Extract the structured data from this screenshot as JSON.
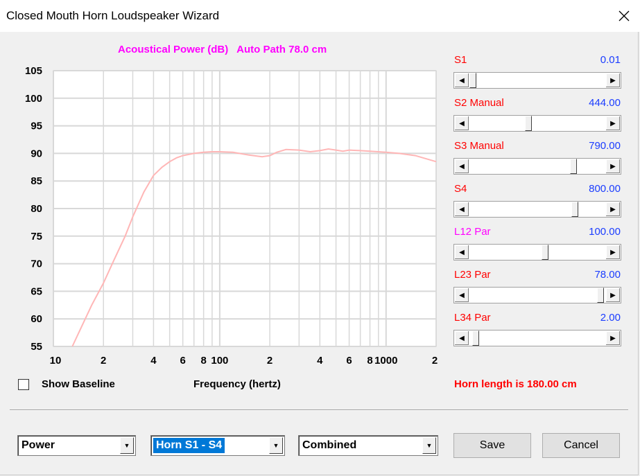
{
  "window": {
    "title": "Closed Mouth Horn Loudspeaker Wizard"
  },
  "chart": {
    "title": "Acoustical Power (dB)   Auto Path 78.0 cm",
    "xlabel": "Frequency (hertz)",
    "y_ticks": [
      "105",
      "100",
      "95",
      "90",
      "85",
      "80",
      "75",
      "70",
      "65",
      "60",
      "55"
    ],
    "x_ticks": [
      "10",
      "2",
      "4",
      "6",
      "8",
      "100",
      "2",
      "4",
      "6",
      "8",
      "1000",
      "2"
    ]
  },
  "chart_data": {
    "type": "line",
    "title": "Acoustical Power (dB)   Auto Path 78.0 cm",
    "xlabel": "Frequency (hertz)",
    "ylabel": "",
    "xscale": "log",
    "xlim": [
      10,
      2000
    ],
    "ylim": [
      55,
      105
    ],
    "grid": true,
    "line_color": "#ffb6b6",
    "series": [
      {
        "x": [
          13,
          15,
          17,
          20,
          23,
          27,
          30,
          35,
          40,
          45,
          50,
          55,
          60,
          70,
          80,
          90,
          100,
          120,
          150,
          180,
          200,
          220,
          250,
          300,
          350,
          400,
          450,
          500,
          550,
          600,
          700,
          800,
          1000,
          1200,
          1500,
          2000
        ],
        "y": [
          55,
          59,
          62.5,
          66.5,
          70.5,
          75,
          78.5,
          83,
          86,
          87.5,
          88.5,
          89.2,
          89.6,
          90,
          90.2,
          90.3,
          90.3,
          90.2,
          89.7,
          89.4,
          89.6,
          90.2,
          90.7,
          90.6,
          90.3,
          90.5,
          90.8,
          90.6,
          90.4,
          90.6,
          90.5,
          90.4,
          90.2,
          90.0,
          89.6,
          88.5
        ]
      }
    ]
  },
  "controls": {
    "show_baseline": "Show Baseline",
    "horn_length": "Horn length is 180.00 cm"
  },
  "sliders": [
    {
      "label": "S1",
      "value": "0.01",
      "color": "#ff0000",
      "position": 0.0
    },
    {
      "label": "S2  Manual",
      "value": "444.00",
      "color": "#ff0000",
      "position": 0.43
    },
    {
      "label": "S3  Manual",
      "value": "790.00",
      "color": "#ff0000",
      "position": 0.78
    },
    {
      "label": "S4",
      "value": "800.00",
      "color": "#ff0000",
      "position": 0.79
    },
    {
      "label": "L12  Par",
      "value": "100.00",
      "color": "#ff00ff",
      "position": 0.56
    },
    {
      "label": "L23  Par",
      "value": "78.00",
      "color": "#ff0000",
      "position": 0.99
    },
    {
      "label": "L34  Par",
      "value": "2.00",
      "color": "#ff0000",
      "position": 0.02
    }
  ],
  "combos": {
    "view": "Power",
    "range": "Horn S1 - S4",
    "mode": "Combined"
  },
  "buttons": {
    "save": "Save",
    "cancel": "Cancel"
  }
}
